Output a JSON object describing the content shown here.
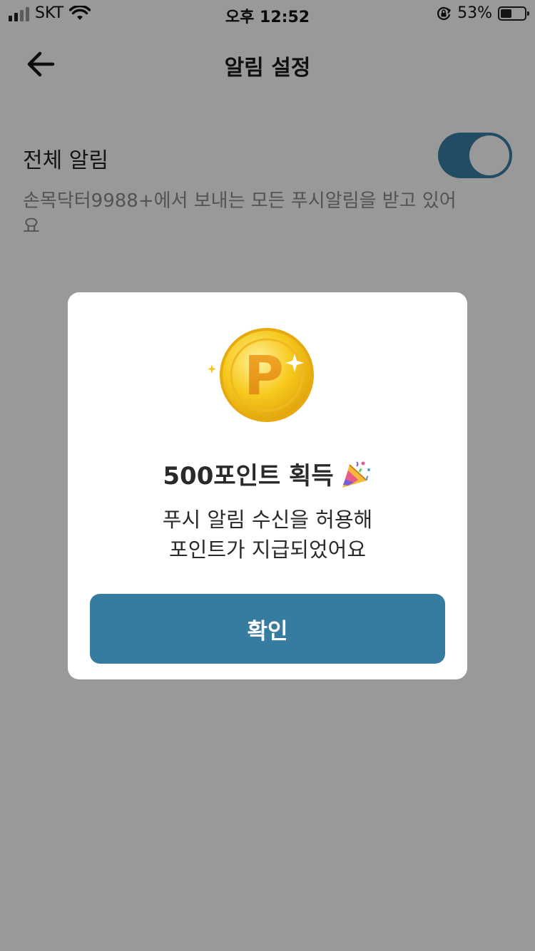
{
  "status_bar": {
    "carrier": "SKT",
    "time": "오후 12:52",
    "battery_percent": "53%",
    "battery_level": 0.53,
    "icons": [
      "signal-icon",
      "wifi-icon",
      "orientation-lock-icon",
      "battery-icon"
    ]
  },
  "nav": {
    "back_icon": "arrow-left-icon",
    "title": "알림 설정"
  },
  "setting": {
    "label": "전체 알림",
    "toggle_on": true,
    "description": "손목닥터9988+에서 보내는 모든 푸시알림을 받고 있어요"
  },
  "modal": {
    "icon": "point-coin-icon",
    "coin_letter": "P",
    "title": "500포인트 획득",
    "title_icon": "party-popper-icon",
    "message_line1": "푸시 알림 수신을 허용해",
    "message_line2": "포인트가 지급되었어요",
    "confirm_label": "확인"
  },
  "colors": {
    "accent": "#367ba0",
    "toggle_on": "#3a7fa5",
    "coin_gold": "#f5c518",
    "overlay": "rgba(0,0,0,0.4)"
  }
}
